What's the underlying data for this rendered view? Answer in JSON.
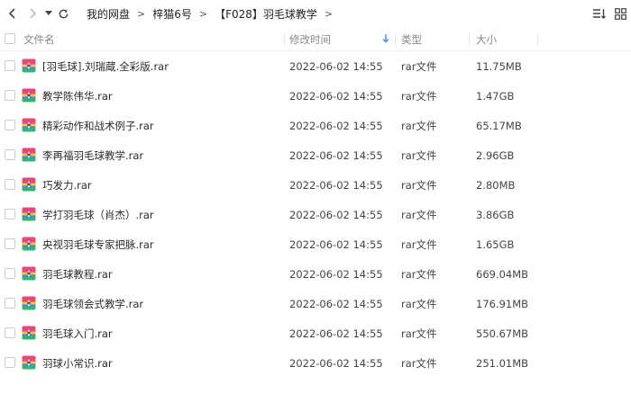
{
  "toolbar": {
    "breadcrumb": [
      "我的网盘",
      "梓猫6号",
      "【F028】羽毛球教学"
    ],
    "separator": ">",
    "back_icon": "chevron-left-icon",
    "forward_icon": "chevron-right-icon",
    "history_icon": "dropdown-icon",
    "refresh_icon": "refresh-icon",
    "sort_icon": "sort-list-icon",
    "view_icon": "grid-view-icon"
  },
  "columns": {
    "name": "文件名",
    "modified": "修改时间",
    "type": "类型",
    "size": "大小"
  },
  "colors": {
    "accent": "#3b8cff",
    "rar_icon_pink": "#e9467a",
    "rar_icon_yellow": "#f6c63a",
    "rar_icon_green": "#37b46b",
    "rar_icon_blue": "#3d8be6"
  },
  "files": [
    {
      "name": "[羽毛球].刘瑞蔵.全彩版.rar",
      "modified": "2022-06-02 14:55",
      "type": "rar文件",
      "size": "11.75MB"
    },
    {
      "name": "教学陈伟华.rar",
      "modified": "2022-06-02 14:55",
      "type": "rar文件",
      "size": "1.47GB"
    },
    {
      "name": "精彩动作和战术例子.rar",
      "modified": "2022-06-02 14:55",
      "type": "rar文件",
      "size": "65.17MB"
    },
    {
      "name": "李再福羽毛球教学.rar",
      "modified": "2022-06-02 14:55",
      "type": "rar文件",
      "size": "2.96GB"
    },
    {
      "name": "巧发力.rar",
      "modified": "2022-06-02 14:55",
      "type": "rar文件",
      "size": "2.80MB"
    },
    {
      "name": "学打羽毛球（肖杰）.rar",
      "modified": "2022-06-02 14:55",
      "type": "rar文件",
      "size": "3.86GB"
    },
    {
      "name": "央视羽毛球专家把脉.rar",
      "modified": "2022-06-02 14:55",
      "type": "rar文件",
      "size": "1.65GB"
    },
    {
      "name": "羽毛球教程.rar",
      "modified": "2022-06-02 14:55",
      "type": "rar文件",
      "size": "669.04MB"
    },
    {
      "name": "羽毛球领会式教学.rar",
      "modified": "2022-06-02 14:55",
      "type": "rar文件",
      "size": "176.91MB"
    },
    {
      "name": "羽毛球入门.rar",
      "modified": "2022-06-02 14:55",
      "type": "rar文件",
      "size": "550.67MB"
    },
    {
      "name": "羽球小常识.rar",
      "modified": "2022-06-02 14:55",
      "type": "rar文件",
      "size": "251.01MB"
    }
  ]
}
